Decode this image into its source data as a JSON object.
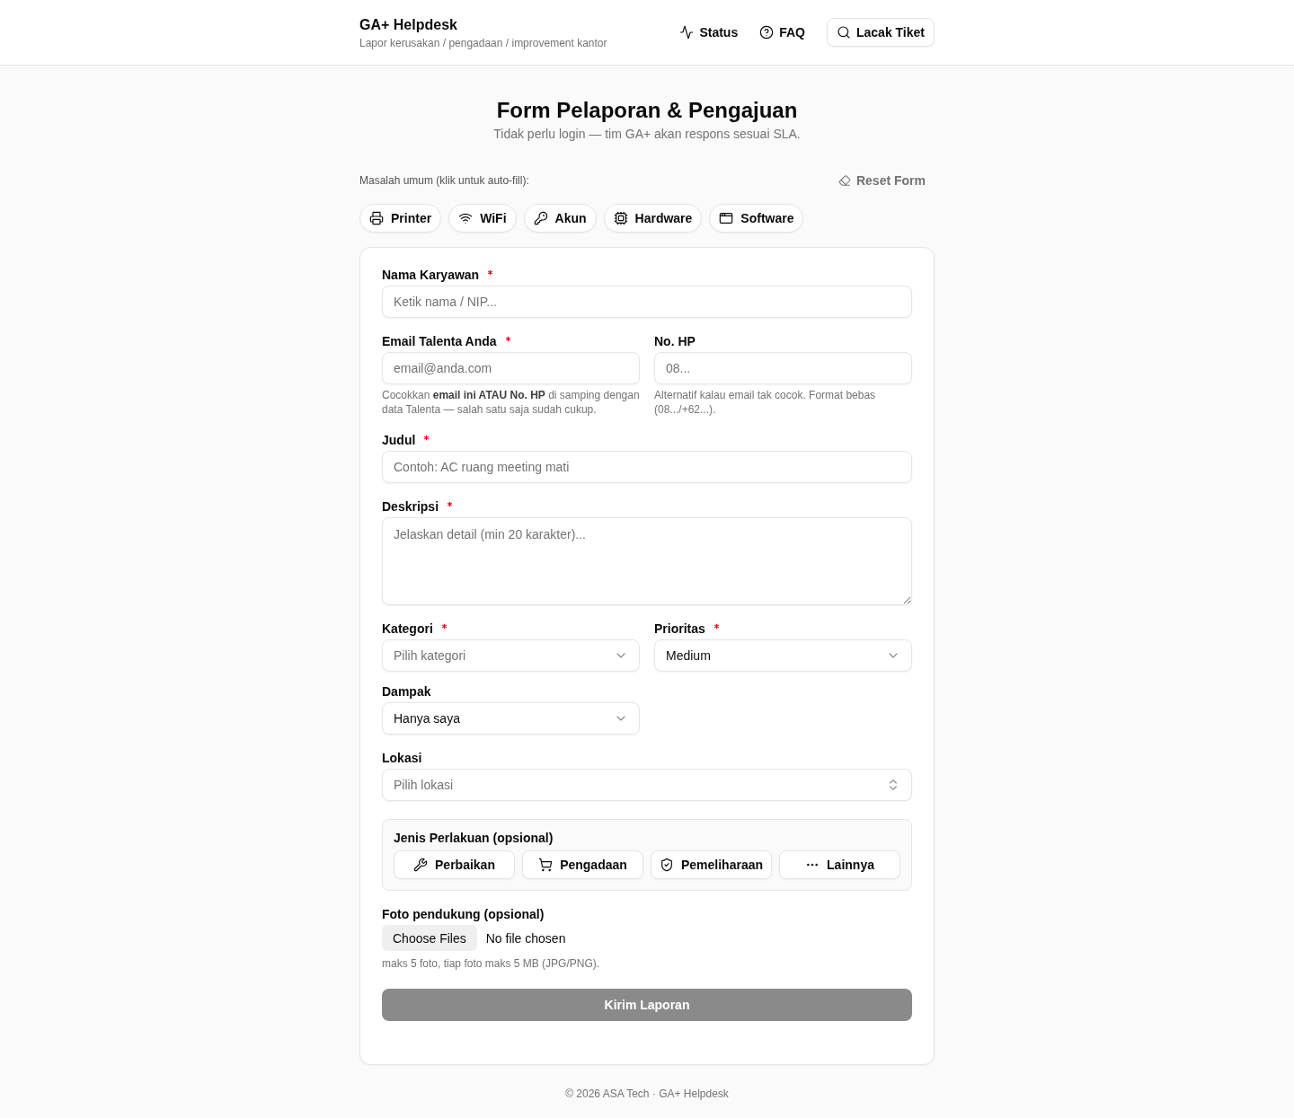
{
  "header": {
    "title": "GA+ Helpdesk",
    "subtitle": "Lapor kerusakan / pengadaan / improvement kantor",
    "nav": [
      {
        "label": "Status",
        "kind": "link"
      },
      {
        "label": "FAQ",
        "kind": "link"
      },
      {
        "label": "Lacak Tiket",
        "kind": "button"
      }
    ]
  },
  "intro": {
    "title": "Form Pelaporan & Pengajuan",
    "subtitle": "Tidak perlu login — tim GA+ akan respons sesuai SLA."
  },
  "quick_fill": {
    "label": "Masalah umum (klik untuk auto-fill):",
    "reset_button": "Reset Form",
    "chips": [
      {
        "label": "Printer"
      },
      {
        "label": "WiFi"
      },
      {
        "label": "Akun"
      },
      {
        "label": "Hardware"
      },
      {
        "label": "Software"
      }
    ]
  },
  "form": {
    "groups": [
      {
        "fields": [
          {
            "kind": "text",
            "label": "Nama Karyawan",
            "required": true,
            "placeholder": "Ketik nama / NIP..."
          }
        ]
      },
      {
        "fields": [
          {
            "kind": "text",
            "label": "Email Talenta Anda",
            "required": true,
            "placeholder": "email@anda.com",
            "help": "Cocokkan **email ini ATAU No. HP** di samping dengan data Talenta — salah satu saja sudah cukup."
          },
          {
            "kind": "text",
            "label": "No. HP",
            "required": false,
            "placeholder": "08...",
            "help": "Alternatif kalau email tak cocok. Format bebas (08.../+62...)."
          }
        ]
      },
      {
        "fields": [
          {
            "kind": "text",
            "label": "Judul",
            "required": true,
            "placeholder": "Contoh: AC ruang meeting mati"
          }
        ]
      },
      {
        "fields": [
          {
            "kind": "textarea",
            "label": "Deskripsi",
            "required": true,
            "placeholder": "Jelaskan detail (min 20 karakter)..."
          }
        ]
      },
      {
        "fields": [
          {
            "kind": "select",
            "label": "Kategori",
            "required": true,
            "placeholder": "Pilih kategori"
          },
          {
            "kind": "select",
            "label": "Prioritas",
            "required": true,
            "value": "Medium"
          },
          {
            "kind": "select",
            "label": "Dampak",
            "required": false,
            "value": "Hanya saya"
          }
        ]
      },
      {
        "fields": [
          {
            "kind": "combobox",
            "label": "Lokasi",
            "required": false,
            "placeholder": "Pilih lokasi"
          }
        ]
      }
    ],
    "treatment": {
      "title": "Jenis Perlakuan (opsional)",
      "options": [
        {
          "label": "Perbaikan",
          "selected": false
        },
        {
          "label": "Pengadaan",
          "selected": false
        },
        {
          "label": "Pemeliharaan",
          "selected": false
        },
        {
          "label": "Lainnya",
          "selected": false
        }
      ]
    },
    "upload": {
      "label": "Foto pendukung (opsional)",
      "button": "Choose Files",
      "status": "No file chosen",
      "help": "maks 5 foto, tiap foto maks 5 MB (JPG/PNG)."
    },
    "submit": {
      "label": "Kirim Laporan",
      "disabled": true
    }
  },
  "footer": {
    "text": "© 2026 ASA Tech · GA+ Helpdesk"
  }
}
